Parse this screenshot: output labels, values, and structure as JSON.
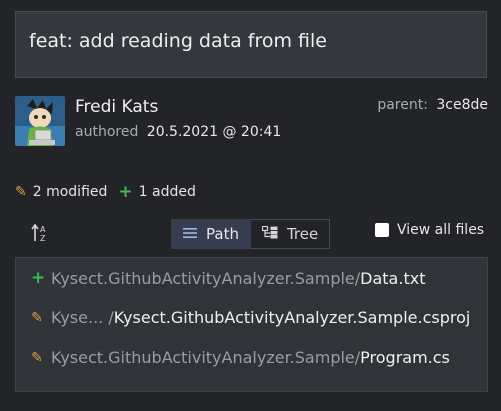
{
  "commit": {
    "message": "feat: add reading data from file",
    "author": "Fredi Kats",
    "authored_label": "authored",
    "authored_date": "20.5.2021 @ 20:41",
    "parent_label": "parent:",
    "parent_hash": "3ce8de"
  },
  "stats": {
    "modified": "2 modified",
    "added": "1 added"
  },
  "view": {
    "path_label": "Path",
    "tree_label": "Tree",
    "selected": "Path",
    "view_all_label": "View all files",
    "view_all_checked": false
  },
  "files": [
    {
      "status": "added",
      "dir": "Kysect.GithubActivityAnalyzer.Sample/",
      "name": "Data.txt"
    },
    {
      "status": "modified",
      "dir": "Kyse... /",
      "name": "Kysect.GithubActivityAnalyzer.Sample.csproj"
    },
    {
      "status": "modified",
      "dir": "Kysect.GithubActivityAnalyzer.Sample/",
      "name": "Program.cs"
    }
  ],
  "colors": {
    "added": "#3fb950",
    "modified": "#e0a040",
    "background": "#222428"
  }
}
